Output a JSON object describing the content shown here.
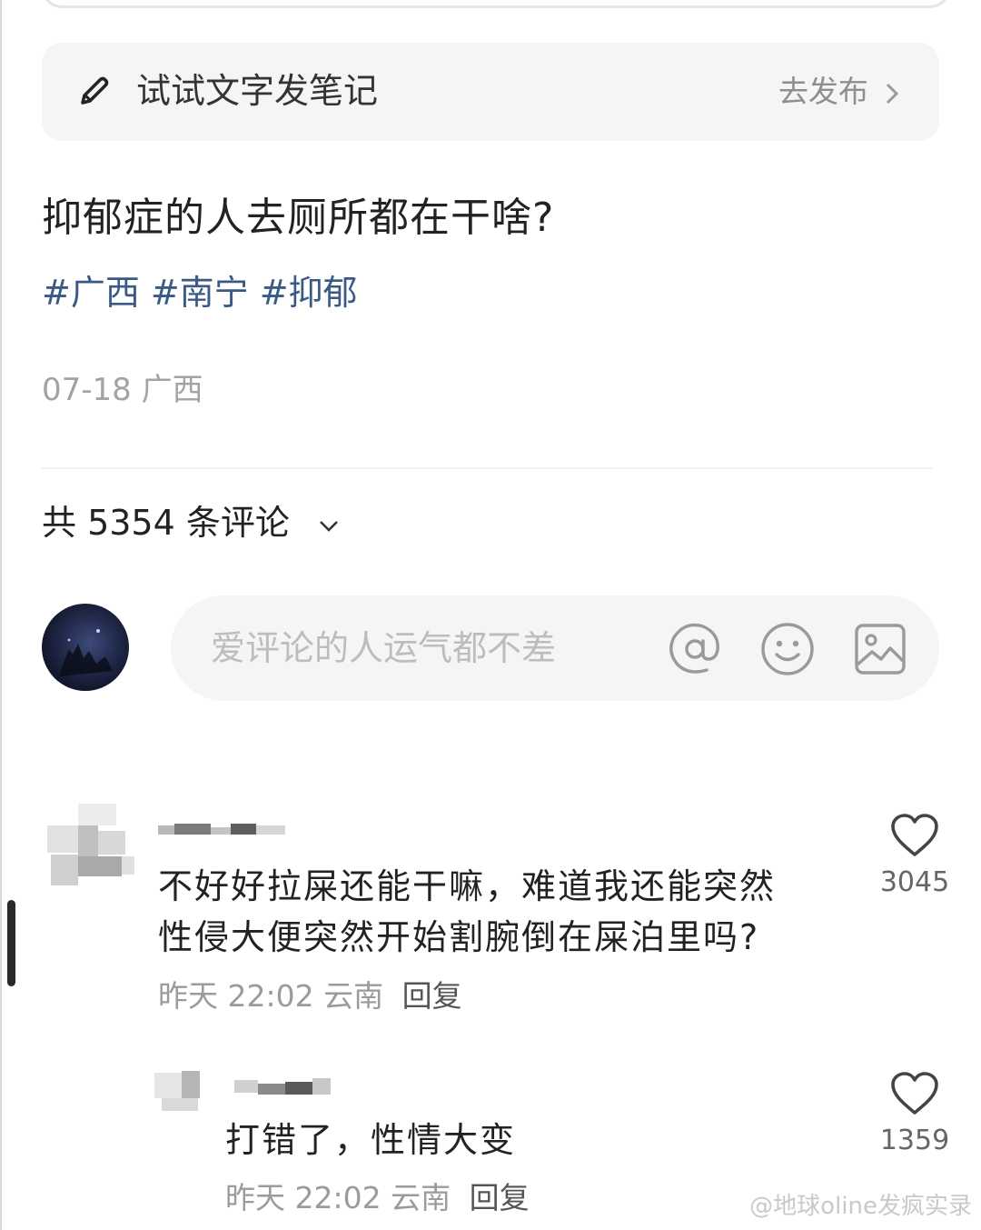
{
  "compose": {
    "label": "试试文字发笔记",
    "publish_label": "去发布"
  },
  "post": {
    "title": "抑郁症的人去厕所都在干啥?",
    "tags": [
      "#广西",
      "#南宁",
      "#抑郁"
    ],
    "date": "07-18",
    "location": "广西"
  },
  "comments_header": {
    "label": "共 5354 条评论"
  },
  "comment_input": {
    "placeholder": "爱评论的人运气都不差"
  },
  "comments": [
    {
      "lines": [
        "不好好拉屎还能干嘛，难道我还能突然",
        "性侵大便突然开始割腕倒在屎泊里吗?"
      ],
      "time": "昨天 22:02",
      "location": "云南",
      "reply_label": "回复",
      "likes": "3045"
    },
    {
      "lines": [
        "打错了，性情大变"
      ],
      "time": "昨天 22:02",
      "location": "云南",
      "reply_label": "回复",
      "likes": "1359"
    }
  ],
  "watermark": "@地球oline发疯实录"
}
